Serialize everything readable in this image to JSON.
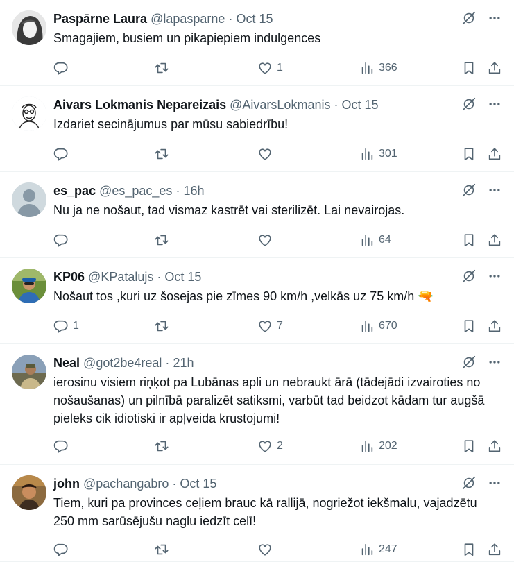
{
  "tweets": [
    {
      "name": "Paspārne Laura",
      "handle": "@lapasparne",
      "time": "Oct 15",
      "text": "Smagajiem, busiem un pikapiepiem indulgences",
      "replies": "",
      "retweets": "",
      "likes": "1",
      "views": "366",
      "avatar": "paspārne"
    },
    {
      "name": "Aivars Lokmanis Nepareizais",
      "handle": "@AivarsLokmanis",
      "time": "Oct 15",
      "text": "Izdariet secinājumus par mūsu sabiedrību!",
      "replies": "",
      "retweets": "",
      "likes": "",
      "views": "301",
      "avatar": "sketch"
    },
    {
      "name": "es_pac",
      "handle": "@es_pac_es",
      "time": "16h",
      "text": "Nu ja ne nošaut, tad vismaz kastrēt vai sterilizēt. Lai nevairojas.",
      "replies": "",
      "retweets": "",
      "likes": "",
      "views": "64",
      "avatar": "default"
    },
    {
      "name": "KP06",
      "handle": "@KPatalujs",
      "time": "Oct 15",
      "text": "Nošaut tos ,kuri uz šosejas pie zīmes 90 km/h ,velkās uz 75 km/h 🔫",
      "replies": "1",
      "retweets": "",
      "likes": "7",
      "views": "670",
      "avatar": "photo-green"
    },
    {
      "name": "Neal",
      "handle": "@got2be4real",
      "time": "21h",
      "text": "ierosinu visiem riņķot pa Lubānas apli un nebraukt ārā (tādejādi izvairoties no nošaušanas) un pilnībā paralizēt satiksmi, varbūt tad beidzot kādam tur augšā pieleks cik idiotiski ir apļveida krustojumi!",
      "replies": "",
      "retweets": "",
      "likes": "2",
      "views": "202",
      "avatar": "photo-outdoor"
    },
    {
      "name": "john",
      "handle": "@pachangabro",
      "time": "Oct 15",
      "text": "Tiem, kuri pa provinces ceļiem brauc kā rallijā, nogriežot iekšmalu, vajadzētu 250 mm sarūsējušu naglu iedzīt celī!",
      "replies": "",
      "retweets": "",
      "likes": "",
      "views": "247",
      "avatar": "photo-man"
    }
  ],
  "separator": "·",
  "icons": {
    "reply": "reply-icon",
    "retweet": "retweet-icon",
    "like": "heart-icon",
    "views": "views-chart-icon",
    "bookmark": "bookmark-icon",
    "share": "share-icon",
    "grok": "grok-icon",
    "more": "more-dots-icon"
  },
  "colors": {
    "text": "#0f1419",
    "secondary": "#536471",
    "divider": "#eff3f4"
  }
}
